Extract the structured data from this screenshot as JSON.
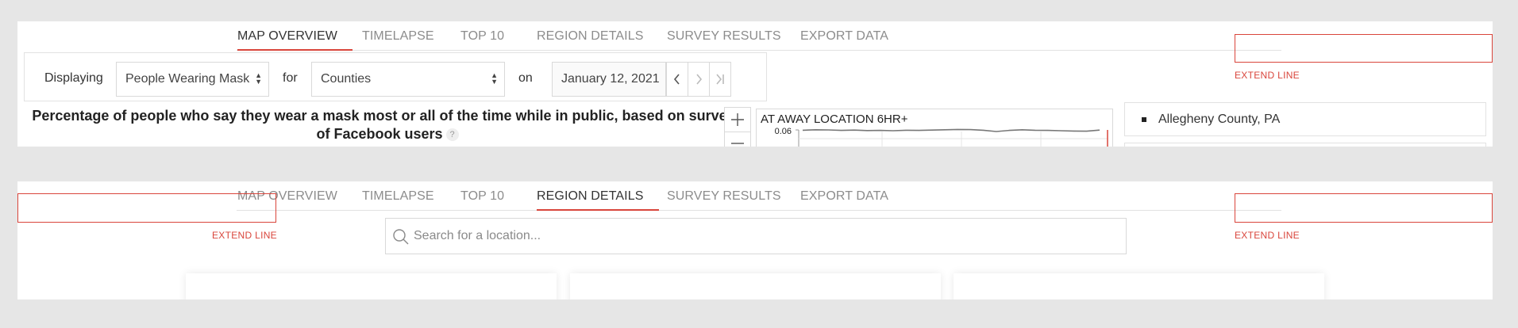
{
  "tabs": [
    {
      "label": "MAP OVERVIEW"
    },
    {
      "label": "TIMELAPSE"
    },
    {
      "label": "TOP 10"
    },
    {
      "label": "REGION DETAILS"
    },
    {
      "label": "SURVEY RESULTS"
    },
    {
      "label": "EXPORT DATA"
    }
  ],
  "panels": [
    {
      "active_tab": "MAP OVERVIEW"
    },
    {
      "active_tab": "REGION DETAILS"
    }
  ],
  "annotation": {
    "label": "EXTEND LINE",
    "color": "#d9453b"
  },
  "controls": {
    "displaying_label": "Displaying",
    "signal_value": "People Wearing Mask",
    "for_label": "for",
    "geo_value": "Counties",
    "on_label": "on",
    "date_value": "January 12, 2021"
  },
  "map": {
    "title": "Percentage of people who say they wear a mask most or all of the time while in public, based on surveys of Facebook users",
    "help_symbol": "?"
  },
  "mini_chart": {
    "title": "AT AWAY LOCATION 6HR+",
    "y_tick": "0.06"
  },
  "chart_data": {
    "type": "line",
    "title": "AT AWAY LOCATION 6HR+",
    "yticks": [
      "0.06"
    ],
    "series": [
      {
        "values": [
          0.0598,
          0.0601,
          0.06,
          0.0597,
          0.0599,
          0.0596,
          0.0597,
          0.0595,
          0.0598,
          0.0597,
          0.0599,
          0.0601,
          0.0603,
          0.0602,
          0.0598,
          0.059,
          0.0597,
          0.0601,
          0.0598,
          0.0597,
          0.0595,
          0.0593,
          0.0592,
          0.0599
        ]
      }
    ]
  },
  "region": {
    "name": "Allegheny County, PA"
  },
  "search": {
    "placeholder": "Search for a location..."
  },
  "colors": {
    "accent": "#d9453b",
    "tab_inactive": "#8c8c8c",
    "tab_active": "#333333",
    "background": "#e6e6e6"
  }
}
